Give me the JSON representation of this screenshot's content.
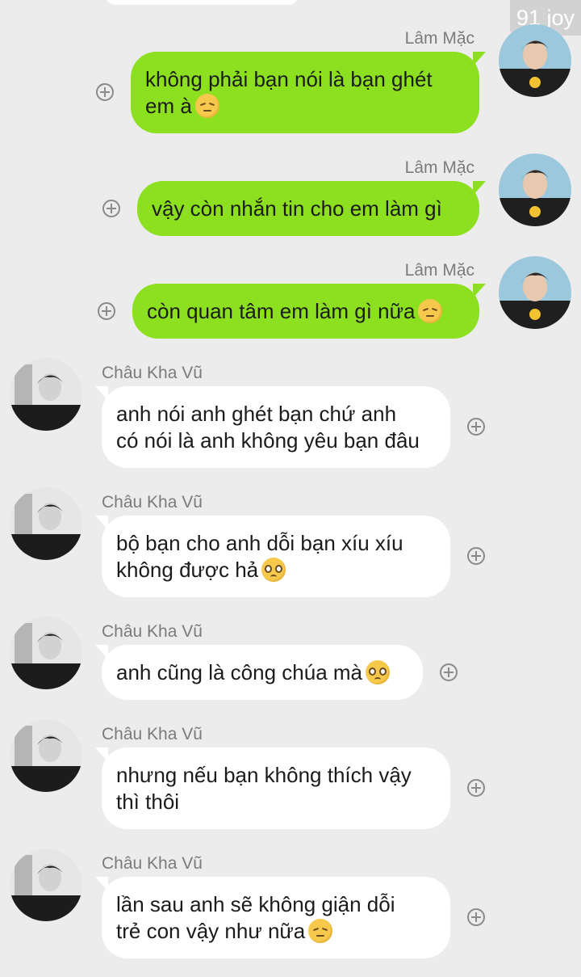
{
  "watermark": "91 joy",
  "contacts": {
    "me": "Lâm Mặc",
    "other": "Châu Kha Vũ"
  },
  "messages": [
    {
      "side": "right",
      "sender": "Lâm Mặc",
      "text": "không phải bạn nói là bạn ghét\nem à",
      "emoji": "pensive-face"
    },
    {
      "side": "right",
      "sender": "Lâm Mặc",
      "text": "vậy còn nhắn tin cho em làm gì",
      "emoji": ""
    },
    {
      "side": "right",
      "sender": "Lâm Mặc",
      "text": "còn quan tâm em làm gì nữa",
      "emoji": "pensive-face"
    },
    {
      "side": "left",
      "sender": "Châu Kha Vũ",
      "text": "anh nói anh ghét bạn chứ anh\ncó nói là anh không yêu bạn đâu",
      "emoji": ""
    },
    {
      "side": "left",
      "sender": "Châu Kha Vũ",
      "text": "bộ bạn cho anh dỗi bạn xíu xíu\nkhông được hả",
      "emoji": "pleading-face"
    },
    {
      "side": "left",
      "sender": "Châu Kha Vũ",
      "text": "anh cũng là công chúa mà",
      "emoji": "pleading-face"
    },
    {
      "side": "left",
      "sender": "Châu Kha Vũ",
      "text": "nhưng nếu bạn không thích vậy\nthì thôi",
      "emoji": ""
    },
    {
      "side": "left",
      "sender": "Châu Kha Vũ",
      "text": "lần sau anh sẽ không giận dỗi\ntrẻ con vậy như nữa",
      "emoji": "pensive-face"
    }
  ],
  "colors": {
    "background": "#ececec",
    "outgoing_bubble": "#8ce01f",
    "incoming_bubble": "#ffffff",
    "sender_name": "#7b7b7b"
  },
  "icons": {
    "add_reaction": "plus-circle-icon"
  }
}
